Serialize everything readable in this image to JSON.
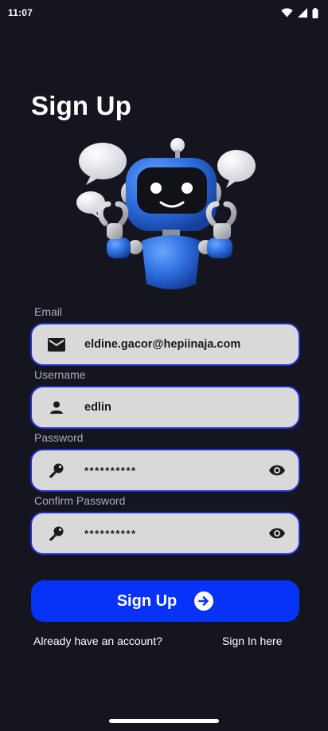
{
  "status_bar": {
    "time": "11:07"
  },
  "title": "Sign Up",
  "form": {
    "email": {
      "label": "Email",
      "value": "eldine.gacor@hepiinaja.com",
      "icon": "mail-icon"
    },
    "username": {
      "label": "Username",
      "value": "edlin",
      "icon": "person-icon"
    },
    "password": {
      "label": "Password",
      "value": "**********",
      "icon": "key-icon"
    },
    "confirm_password": {
      "label": "Confirm Password",
      "value": "**********",
      "icon": "key-icon"
    }
  },
  "button": {
    "label": "Sign Up",
    "icon": "arrow-right-circle-icon"
  },
  "footer": {
    "prompt": "Already have an account?",
    "link": "Sign In here"
  },
  "colors": {
    "background": "#14151f",
    "field_background": "#d9d9d9",
    "field_border": "#1e2fd6",
    "button": "#0633f7",
    "label": "#a9abb8"
  }
}
